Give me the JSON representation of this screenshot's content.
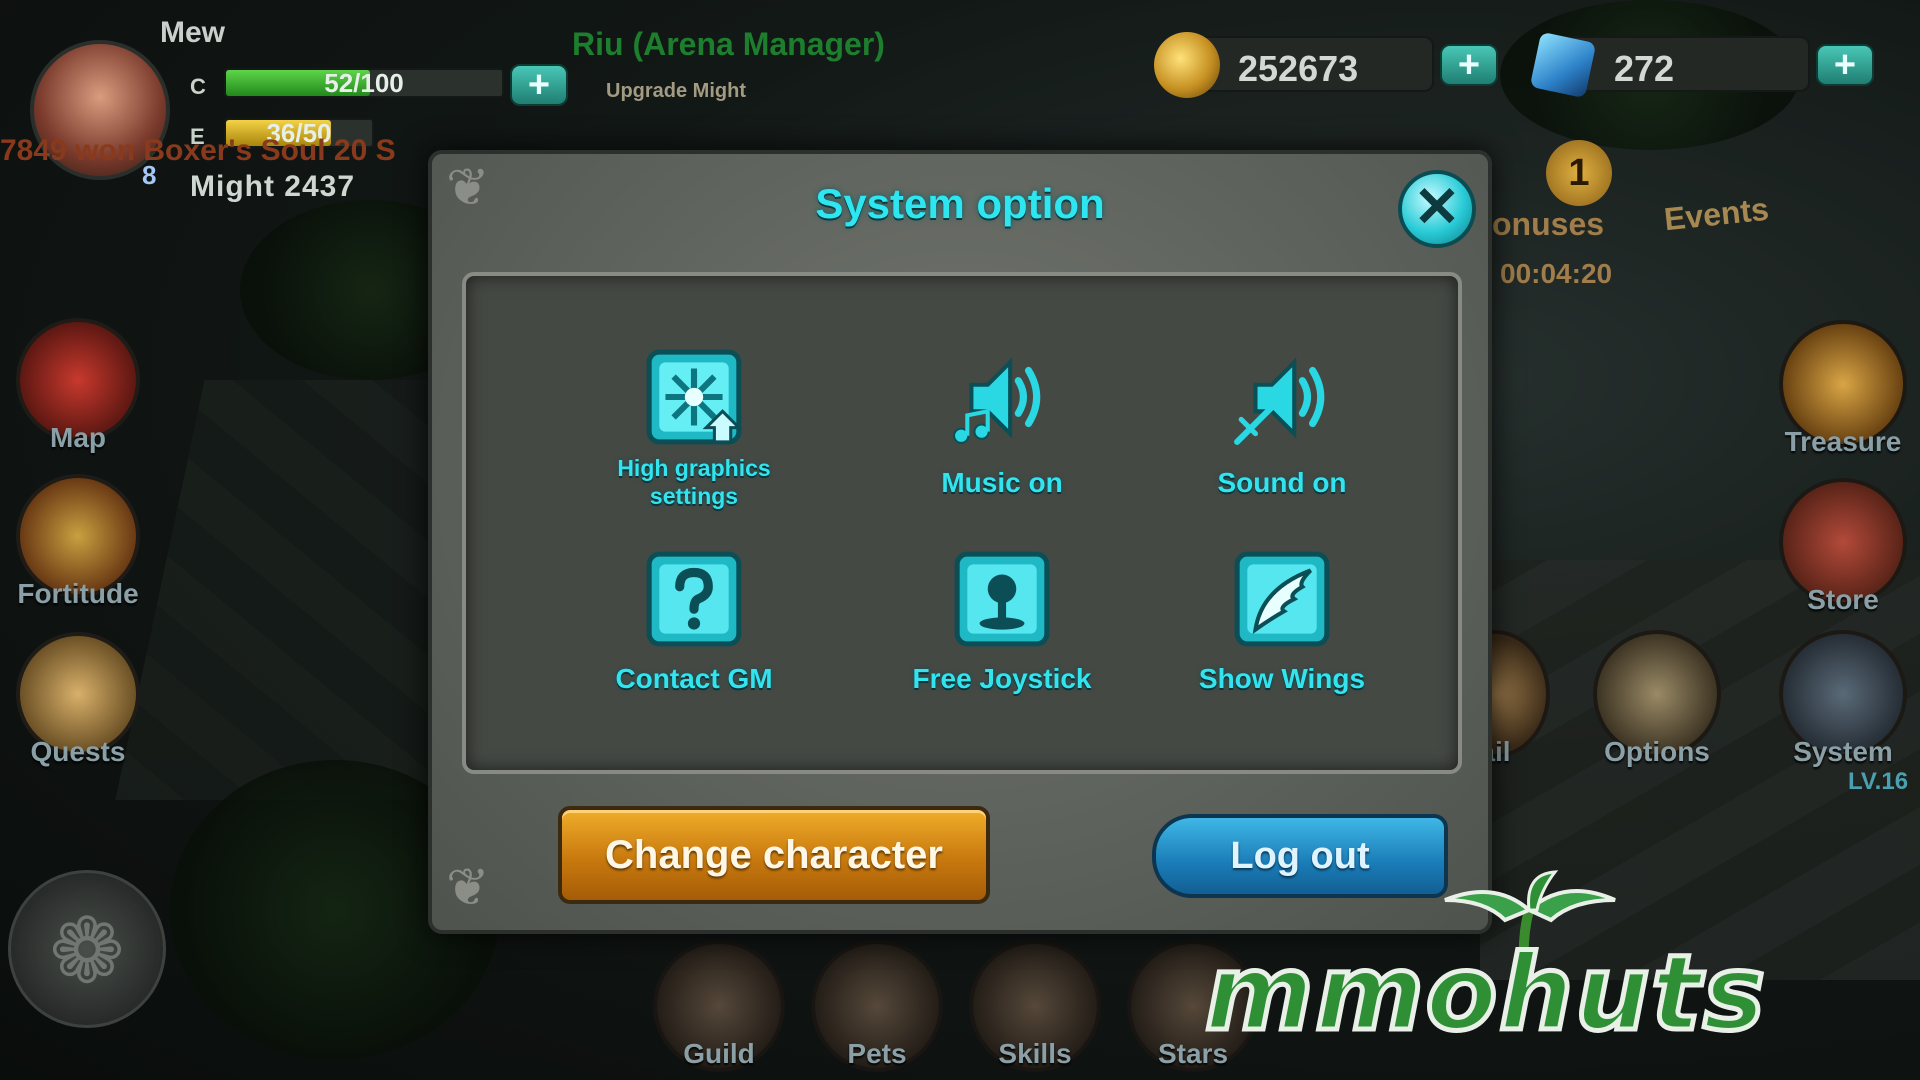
{
  "player": {
    "name": "Mew",
    "hp_label": "C",
    "hp_text": "52/100",
    "hp_fraction": 0.52,
    "energy_label": "E",
    "energy_text": "36/50",
    "energy_fraction": 0.72,
    "level": "8",
    "might": "Might  2437"
  },
  "chat_message": "7849 won Boxer's Soul 20 S",
  "npc": {
    "name": "Riu (Arena Manager)",
    "sub_label": "Upgrade Might"
  },
  "currency": {
    "gold": "252673",
    "diamonds": "272"
  },
  "left_menu": [
    {
      "label": "Map"
    },
    {
      "label": "Fortitude"
    },
    {
      "label": "Quests"
    }
  ],
  "right_menu": [
    {
      "label": "Treasure"
    },
    {
      "label": "Store"
    },
    {
      "label": "Options"
    },
    {
      "label": "System"
    }
  ],
  "right_extra": {
    "mail_label": "ail",
    "bonuses_label": "onuses",
    "timer": "00:04:20",
    "events_label": "Events",
    "badge_count": "1",
    "lv_text": "LV.16"
  },
  "bottom_menu": [
    {
      "label": "Guild"
    },
    {
      "label": "Pets"
    },
    {
      "label": "Skills"
    },
    {
      "label": "Stars"
    }
  ],
  "dialog": {
    "title": "System option",
    "options": [
      {
        "label_line1": "High graphics",
        "label_line2": "settings",
        "icon": "graphics-icon"
      },
      {
        "label": "Music on",
        "icon": "music-icon"
      },
      {
        "label": "Sound on",
        "icon": "sound-icon"
      },
      {
        "label": "Contact GM",
        "icon": "question-icon"
      },
      {
        "label": "Free Joystick",
        "icon": "joystick-icon"
      },
      {
        "label": "Show Wings",
        "icon": "wings-icon"
      }
    ],
    "change_character_label": "Change character",
    "logout_label": "Log out"
  },
  "watermark": {
    "text": "mmohuts"
  },
  "colors": {
    "accent_cyan": "#33e3ee",
    "orange_button": "#e89a1c",
    "blue_button": "#1a7cb7",
    "hp_green": "#2fb02a",
    "energy_yellow": "#d8b21c"
  }
}
